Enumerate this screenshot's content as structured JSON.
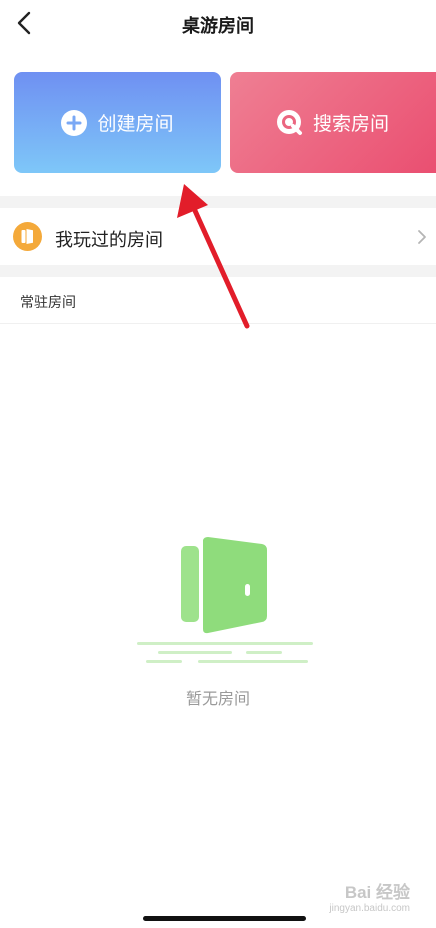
{
  "nav": {
    "title": "桌游房间",
    "back_icon": "chevron-left-icon"
  },
  "actions": {
    "create": {
      "label": "创建房间",
      "icon": "plus-circle-icon"
    },
    "search": {
      "label": "搜索房间",
      "icon": "search-icon"
    }
  },
  "played": {
    "label": "我玩过的房间",
    "icon": "door-icon",
    "chevron": "chevron-right-icon"
  },
  "section": {
    "title": "常驻房间"
  },
  "empty": {
    "text": "暂无房间",
    "icon": "empty-door-icon"
  },
  "colors": {
    "create_gradient": [
      "#6f90f2",
      "#7ec7f8"
    ],
    "search_gradient": [
      "#ef7f93",
      "#ea4f71"
    ],
    "annotation_arrow": "#e21d2a",
    "illustration_green": "#9ee28c",
    "played_icon": "#f4a93a"
  },
  "watermark": {
    "brand": "Bai 经验",
    "url": "jingyan.baidu.com"
  }
}
